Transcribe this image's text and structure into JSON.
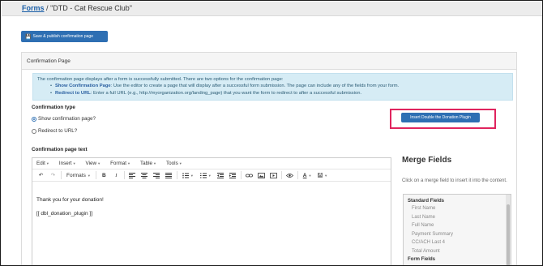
{
  "breadcrumb": {
    "parent": "Forms",
    "separator": "/",
    "current": "\"DTD - Cat Rescue Club\""
  },
  "publish_button": {
    "label": "Save & publish confirmation page",
    "icon": "save-icon"
  },
  "panel": {
    "title": "Confirmation Page",
    "info": {
      "intro": "The confirmation page displays after a form is successfully submitted. There are two options for the confirmation page:",
      "items": [
        {
          "label": "Show Confirmation Page",
          "text": ": Use the editor to create a page that will display after a successful form submission. The page can include any of the fields from your form."
        },
        {
          "label": "Redirect to URL",
          "text": ": Enter a full URL (e.g., http://myorganization.org/landing_page) that you want the form to redirect to after a successful submission."
        }
      ]
    },
    "confirmation_type": {
      "label": "Confirmation type",
      "options": [
        {
          "label": "Show confirmation page?",
          "checked": true
        },
        {
          "label": "Redirect to URL?",
          "checked": false
        }
      ]
    },
    "plugin_button": {
      "label": "Insert Double the Donation Plugin"
    },
    "editor": {
      "label": "Confirmation page text",
      "menus": [
        "Edit",
        "Insert",
        "View",
        "Format",
        "Table",
        "Tools"
      ],
      "formats_label": "Formats",
      "content": [
        "Thank you for your donation!",
        "[[ dbl_donation_plugin ]]"
      ]
    }
  },
  "merge_fields": {
    "title": "Merge Fields",
    "description": "Click on a merge field to insert it into the content.",
    "groups": [
      {
        "name": "Standard Fields",
        "items": [
          "First Name",
          "Last Name",
          "Full Name",
          "Payment Summary",
          "CC/ACH Last 4",
          "Total Amount"
        ]
      },
      {
        "name": "Form Fields",
        "items": []
      }
    ]
  },
  "colors": {
    "primary": "#2e6fb3",
    "highlight": "#e0245e",
    "info_bg": "#d6ecf5"
  }
}
